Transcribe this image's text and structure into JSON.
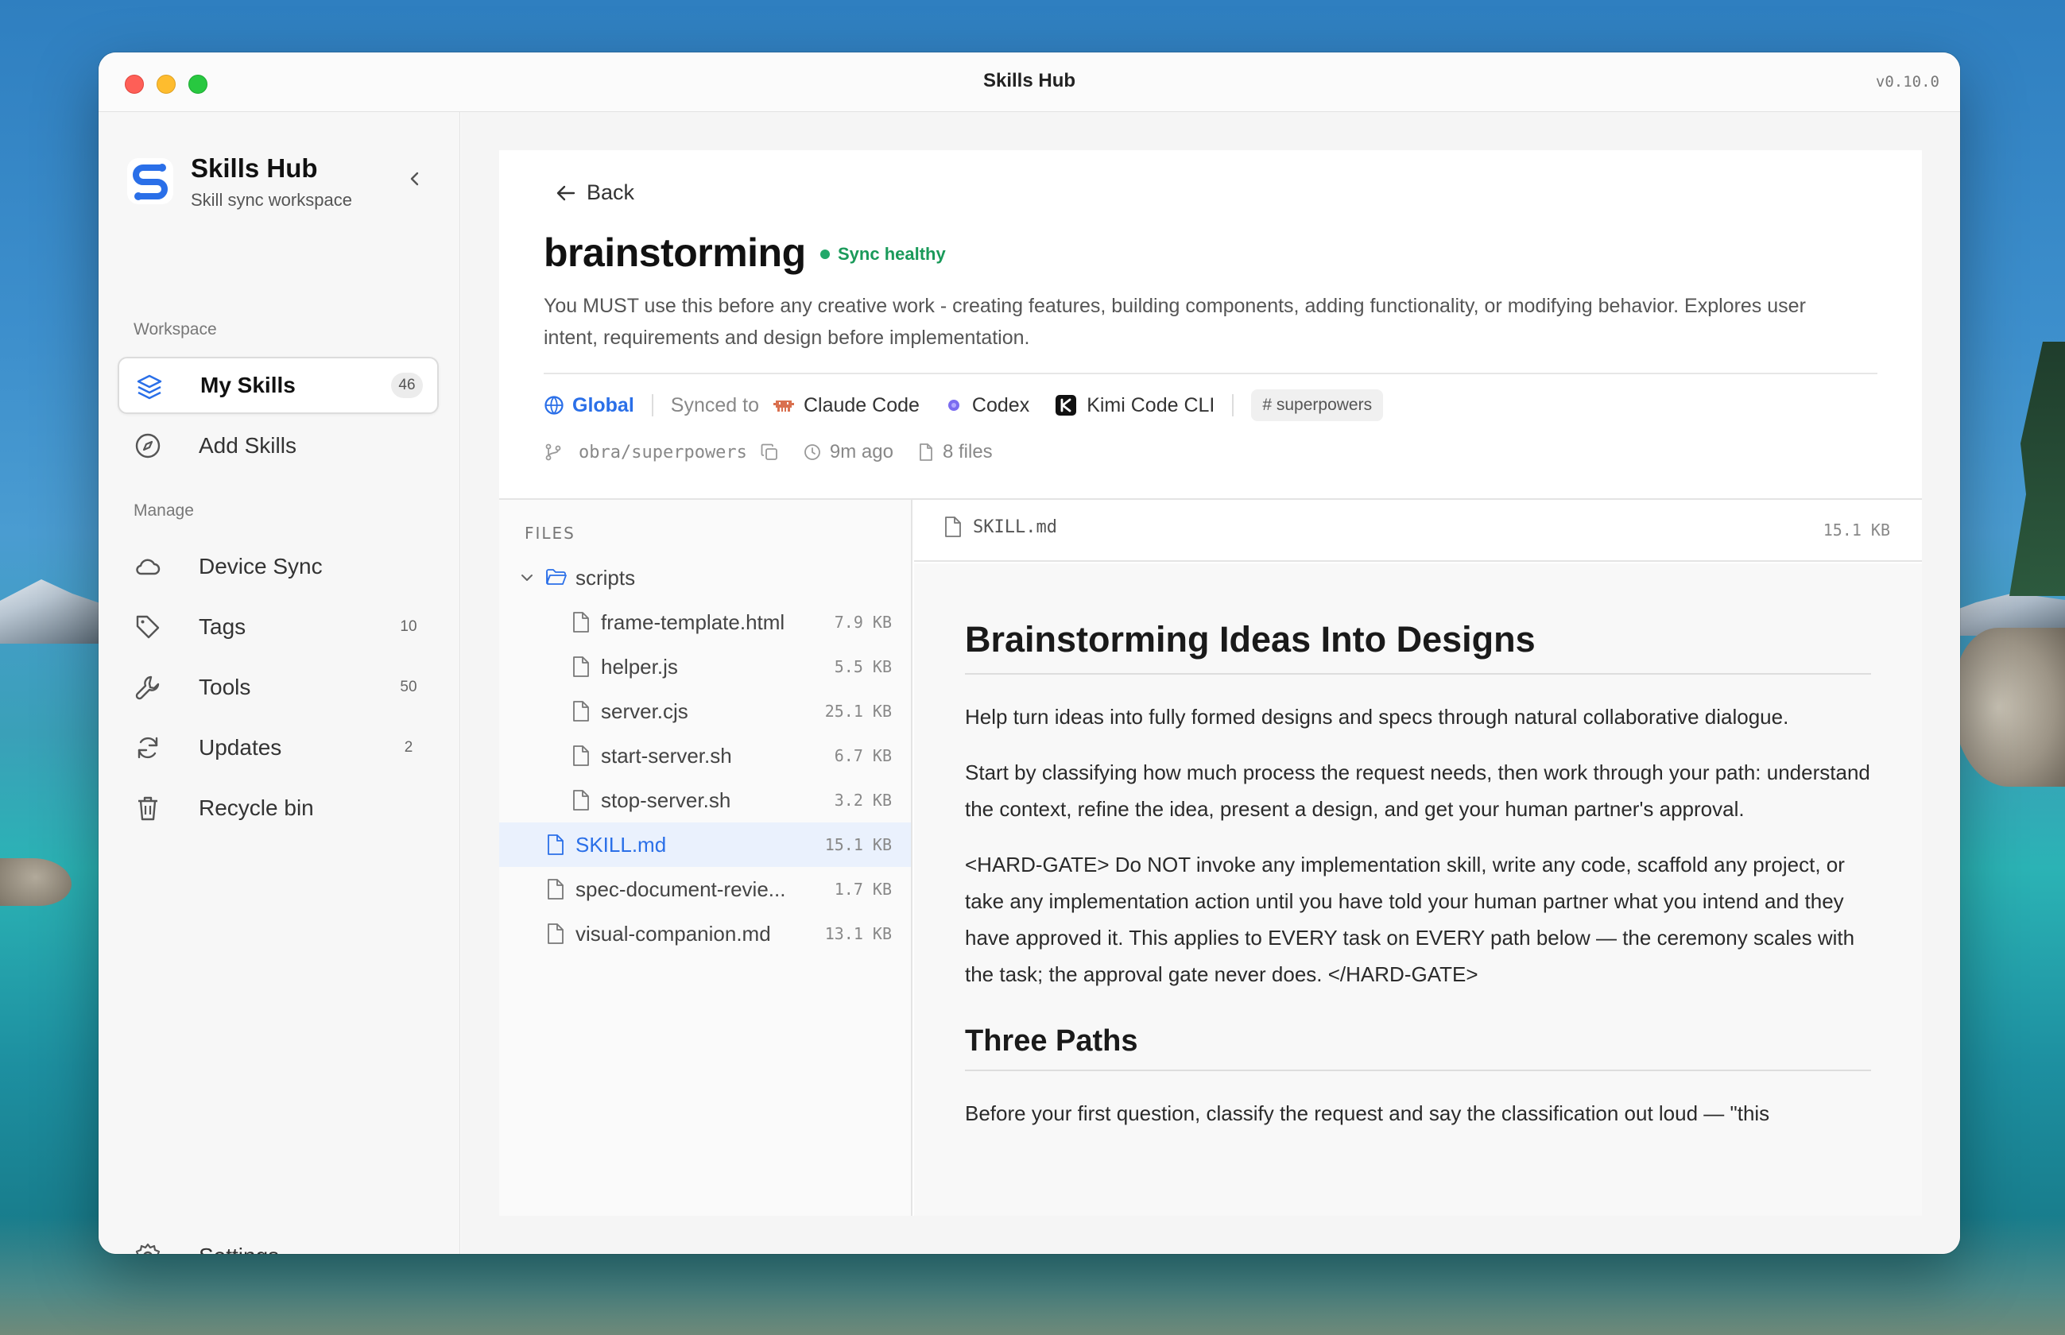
{
  "window": {
    "title": "Skills Hub",
    "version": "v0.10.0"
  },
  "sidebar": {
    "brand_name": "Skills Hub",
    "brand_sub": "Skill sync workspace",
    "workspace_label": "Workspace",
    "manage_label": "Manage",
    "items": [
      {
        "label": "My Skills",
        "count": "46",
        "icon": "layers-icon",
        "active": true
      },
      {
        "label": "Add Skills",
        "count": "",
        "icon": "compass-icon"
      },
      {
        "label": "Device Sync",
        "count": "",
        "icon": "cloud-icon"
      },
      {
        "label": "Tags",
        "count": "10",
        "icon": "tag-icon"
      },
      {
        "label": "Tools",
        "count": "50",
        "icon": "wrench-icon"
      },
      {
        "label": "Updates",
        "count": "2",
        "icon": "refresh-icon"
      },
      {
        "label": "Recycle bin",
        "count": "",
        "icon": "trash-icon"
      }
    ],
    "settings_label": "Settings"
  },
  "skill": {
    "back_label": "Back",
    "name": "brainstorming",
    "status": "Sync healthy",
    "description": "You MUST use this before any creative work - creating features, building components, adding functionality, or modifying behavior. Explores user intent, requirements and design before implementation.",
    "scope": "Global",
    "synced_to_label": "Synced to",
    "agents": [
      "Claude Code",
      "Codex",
      "Kimi Code CLI"
    ],
    "tag": "# superpowers",
    "repo": "obra/superpowers",
    "updated": "9m ago",
    "file_count": "8 files"
  },
  "files": {
    "label": "FILES",
    "folder": "scripts",
    "entries": [
      {
        "name": "frame-template.html",
        "size": "7.9 KB"
      },
      {
        "name": "helper.js",
        "size": "5.5 KB"
      },
      {
        "name": "server.cjs",
        "size": "25.1 KB"
      },
      {
        "name": "start-server.sh",
        "size": "6.7 KB"
      },
      {
        "name": "stop-server.sh",
        "size": "3.2 KB"
      },
      {
        "name": "SKILL.md",
        "size": "15.1 KB"
      },
      {
        "name": "spec-document-revie...",
        "size": "1.7 KB"
      },
      {
        "name": "visual-companion.md",
        "size": "13.1 KB"
      }
    ]
  },
  "preview": {
    "file": "SKILL.md",
    "size": "15.1 KB",
    "h1": "Brainstorming Ideas Into Designs",
    "p1": "Help turn ideas into fully formed designs and specs through natural collaborative dialogue.",
    "p2": "Start by classifying how much process the request needs, then work through your path: understand the context, refine the idea, present a design, and get your human partner's approval.",
    "p3": "<HARD-GATE> Do NOT invoke any implementation skill, write any code, scaffold any project, or take any implementation action until you have told your human partner what you intend and they have approved it. This applies to EVERY task on EVERY path below — the ceremony scales with the task; the approval gate never does. </HARD-GATE>",
    "h2": "Three Paths",
    "p4": "Before your first question, classify the request and say the classification out loud — \"this"
  },
  "colors": {
    "accent": "#2a6fe8",
    "status_green": "#1a9a5a"
  }
}
